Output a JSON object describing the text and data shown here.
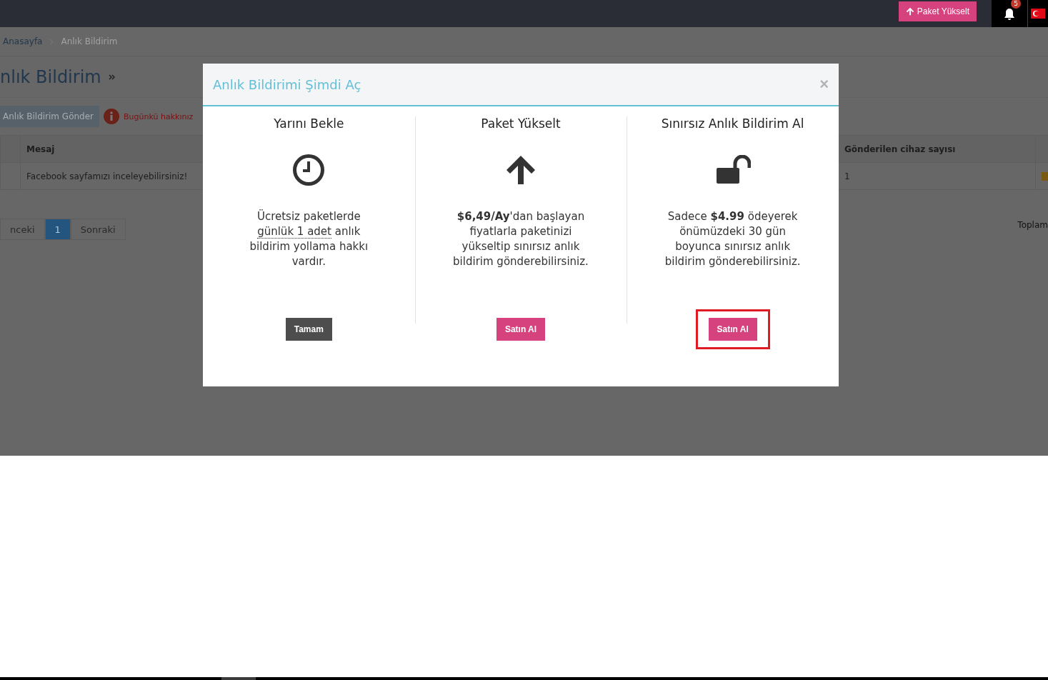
{
  "topbar": {
    "upgrade_button": "Paket Yükselt",
    "notification_count": "5"
  },
  "breadcrumb": [
    "Anasayfa",
    "Anlık Bildirim"
  ],
  "page_title": "nlık Bildirim",
  "send_button": "Anlık Bildirim Gönder",
  "limit_notice": "Bugünkü hakkınız",
  "table": {
    "columns": [
      "Mesaj",
      "Gönderilen cihaz sayısı"
    ],
    "rows": [
      [
        "Facebook sayfamızı inceleyebilirsiniz!",
        "1"
      ]
    ]
  },
  "pagination": [
    {
      "label": "nceki",
      "selected": false
    },
    {
      "label": "1",
      "selected": true
    },
    {
      "label": "Sonraki",
      "selected": false
    }
  ],
  "total_label": "Toplam",
  "modal": {
    "title": "Anlık Bildirimi Şimdi Aç",
    "close": "×",
    "options": [
      {
        "title": "Yarını Bekle",
        "description": [
          {
            "text": "Ücretsiz paketlerde "
          },
          {
            "text": "günlük 1 adet",
            "underlined": true
          },
          {
            "text": " anlık bildirim yollama hakkı vardır."
          }
        ],
        "button": {
          "label": "Tamam",
          "kind": "dark",
          "highlighted": false
        }
      },
      {
        "title": "Paket Yükselt",
        "description": [
          {
            "text": "**$6,49/Ay**'dan başlayan fiyatlarla paketinizi yükseltip sınırsız anlık bildirim gönderebilirsiniz."
          }
        ],
        "button": {
          "label": "Satın Al",
          "kind": "pink",
          "highlighted": false
        }
      },
      {
        "title": "Sınırsız Anlık Bildirim Al",
        "description": [
          {
            "text": "Sadece **$4.99** ödeyerek önümüzdeki 30 gün boyunca sınırsız anlık bildirim gönderebilirsiniz."
          }
        ],
        "button": {
          "label": "Satın Al",
          "kind": "pink",
          "highlighted": true
        }
      }
    ]
  }
}
